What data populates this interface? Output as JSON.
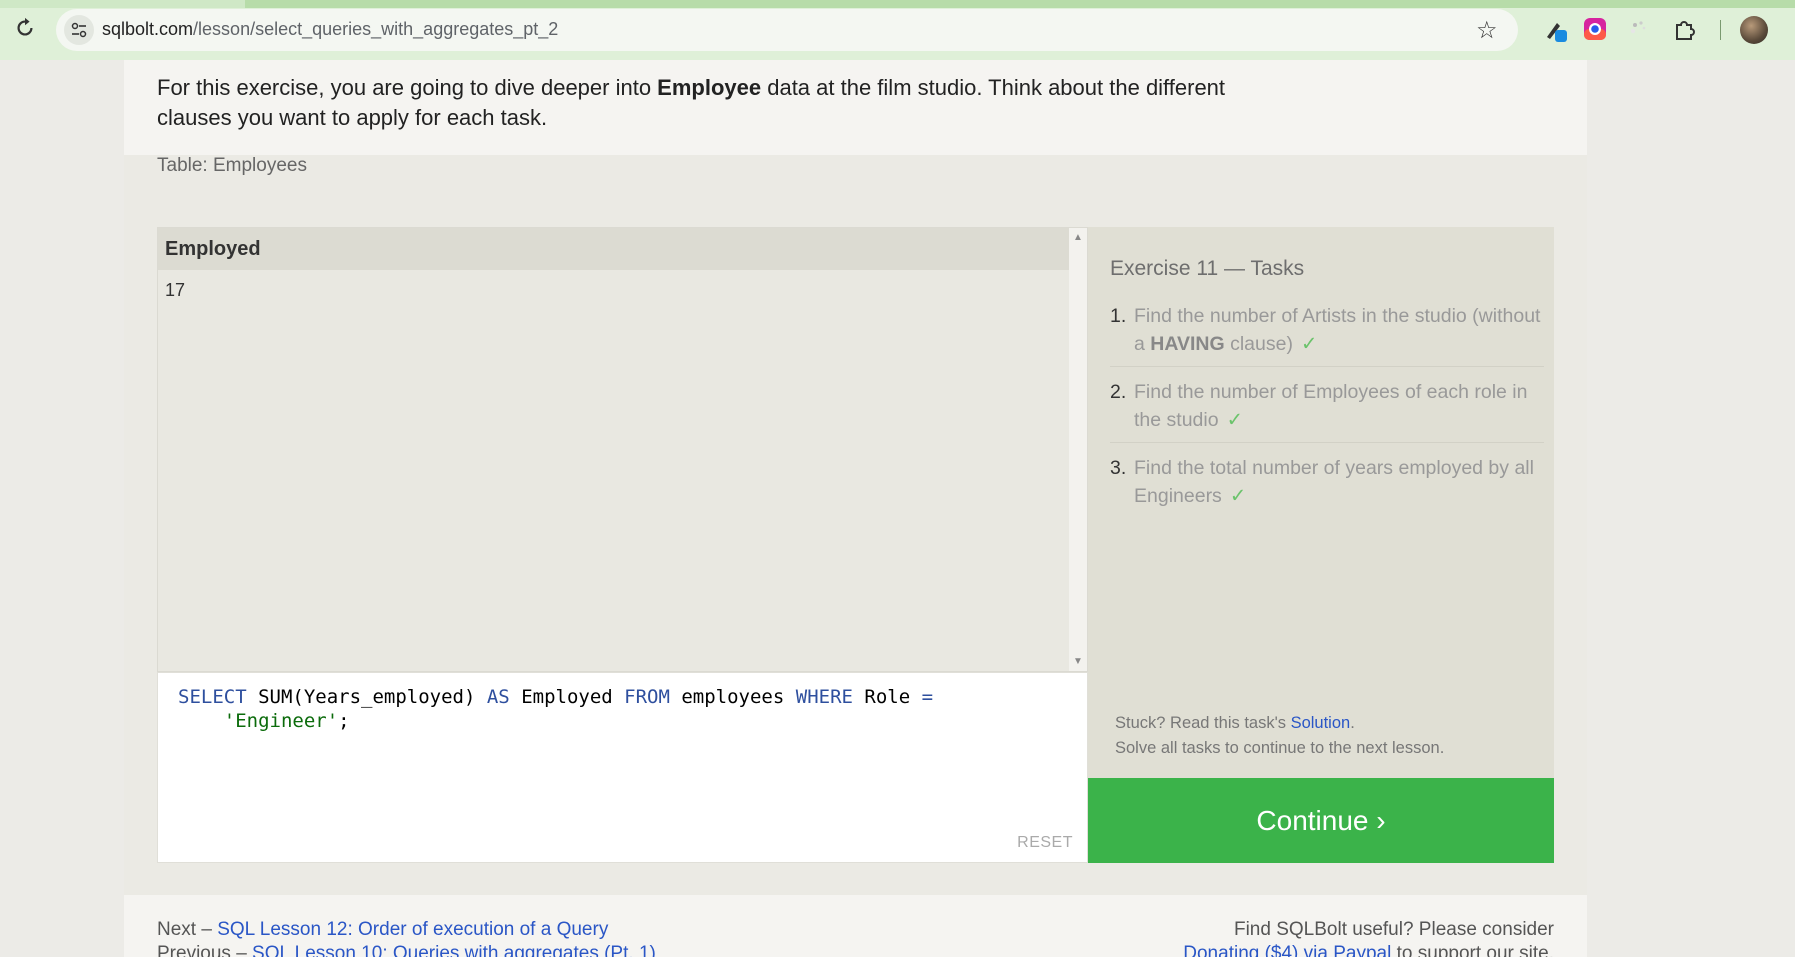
{
  "browser": {
    "url_domain": "sqlbolt.com",
    "url_path": "/lesson/select_queries_with_aggregates_pt_2"
  },
  "intro": {
    "text_before": "For this exercise, you are going to dive deeper into ",
    "bold": "Employee",
    "text_after": " data at the film studio. Think about the different clauses you want to apply for each task."
  },
  "table": {
    "label": "Table: Employees",
    "columns": [
      "Employed"
    ],
    "rows": [
      [
        "17"
      ]
    ]
  },
  "editor": {
    "tokens": [
      {
        "t": "SELECT",
        "c": "kw"
      },
      {
        "t": " SUM(Years_employed) ",
        "c": ""
      },
      {
        "t": "AS",
        "c": "kw"
      },
      {
        "t": " Employed ",
        "c": ""
      },
      {
        "t": "FROM",
        "c": "kw"
      },
      {
        "t": " employees ",
        "c": ""
      },
      {
        "t": "WHERE",
        "c": "kw"
      },
      {
        "t": " Role ",
        "c": ""
      },
      {
        "t": "=",
        "c": "kw"
      },
      {
        "t": "\n    ",
        "c": ""
      },
      {
        "t": "'Engineer'",
        "c": "str"
      },
      {
        "t": ";",
        "c": ""
      }
    ],
    "reset_label": "RESET"
  },
  "tasks": {
    "title": "Exercise 11 — Tasks",
    "items": [
      {
        "num": "1.",
        "text_before": "Find the number of Artists in the studio (without a ",
        "bold": "HAVING",
        "text_after": " clause)",
        "check": "✓"
      },
      {
        "num": "2.",
        "text_before": "Find the number of Employees of each role in the studio",
        "bold": "",
        "text_after": "",
        "check": "✓"
      },
      {
        "num": "3.",
        "text_before": "Find the total number of years employed by all Engineers",
        "bold": "",
        "text_after": "",
        "check": "✓"
      }
    ],
    "stuck_prefix": "Stuck? Read this task's ",
    "stuck_link": "Solution",
    "stuck_suffix": ".",
    "solve_text": "Solve all tasks to continue to the next lesson."
  },
  "continue_label": "Continue ›",
  "footer": {
    "next_prefix": "Next – ",
    "next_link": "SQL Lesson 12: Order of execution of a Query",
    "prev_prefix": "Previous – ",
    "prev_link": "SQL Lesson 10: Queries with aggregates (Pt. 1)",
    "useful_text": "Find SQLBolt useful? Please consider",
    "donate_link": "Donating ($4) via Paypal",
    "donate_suffix": " to support our site."
  },
  "colors": {
    "continue_bg": "#3bb34a",
    "link": "#2a56c6",
    "sql_keyword": "#2e4f9e",
    "sql_string": "#0b6b0b"
  },
  "icons": [
    "reload-icon",
    "site-settings-icon",
    "bookmark-star-icon",
    "extension-pen-icon",
    "extension-instagram-icon",
    "extension-loader-icon",
    "extensions-puzzle-icon",
    "profile-avatar"
  ]
}
